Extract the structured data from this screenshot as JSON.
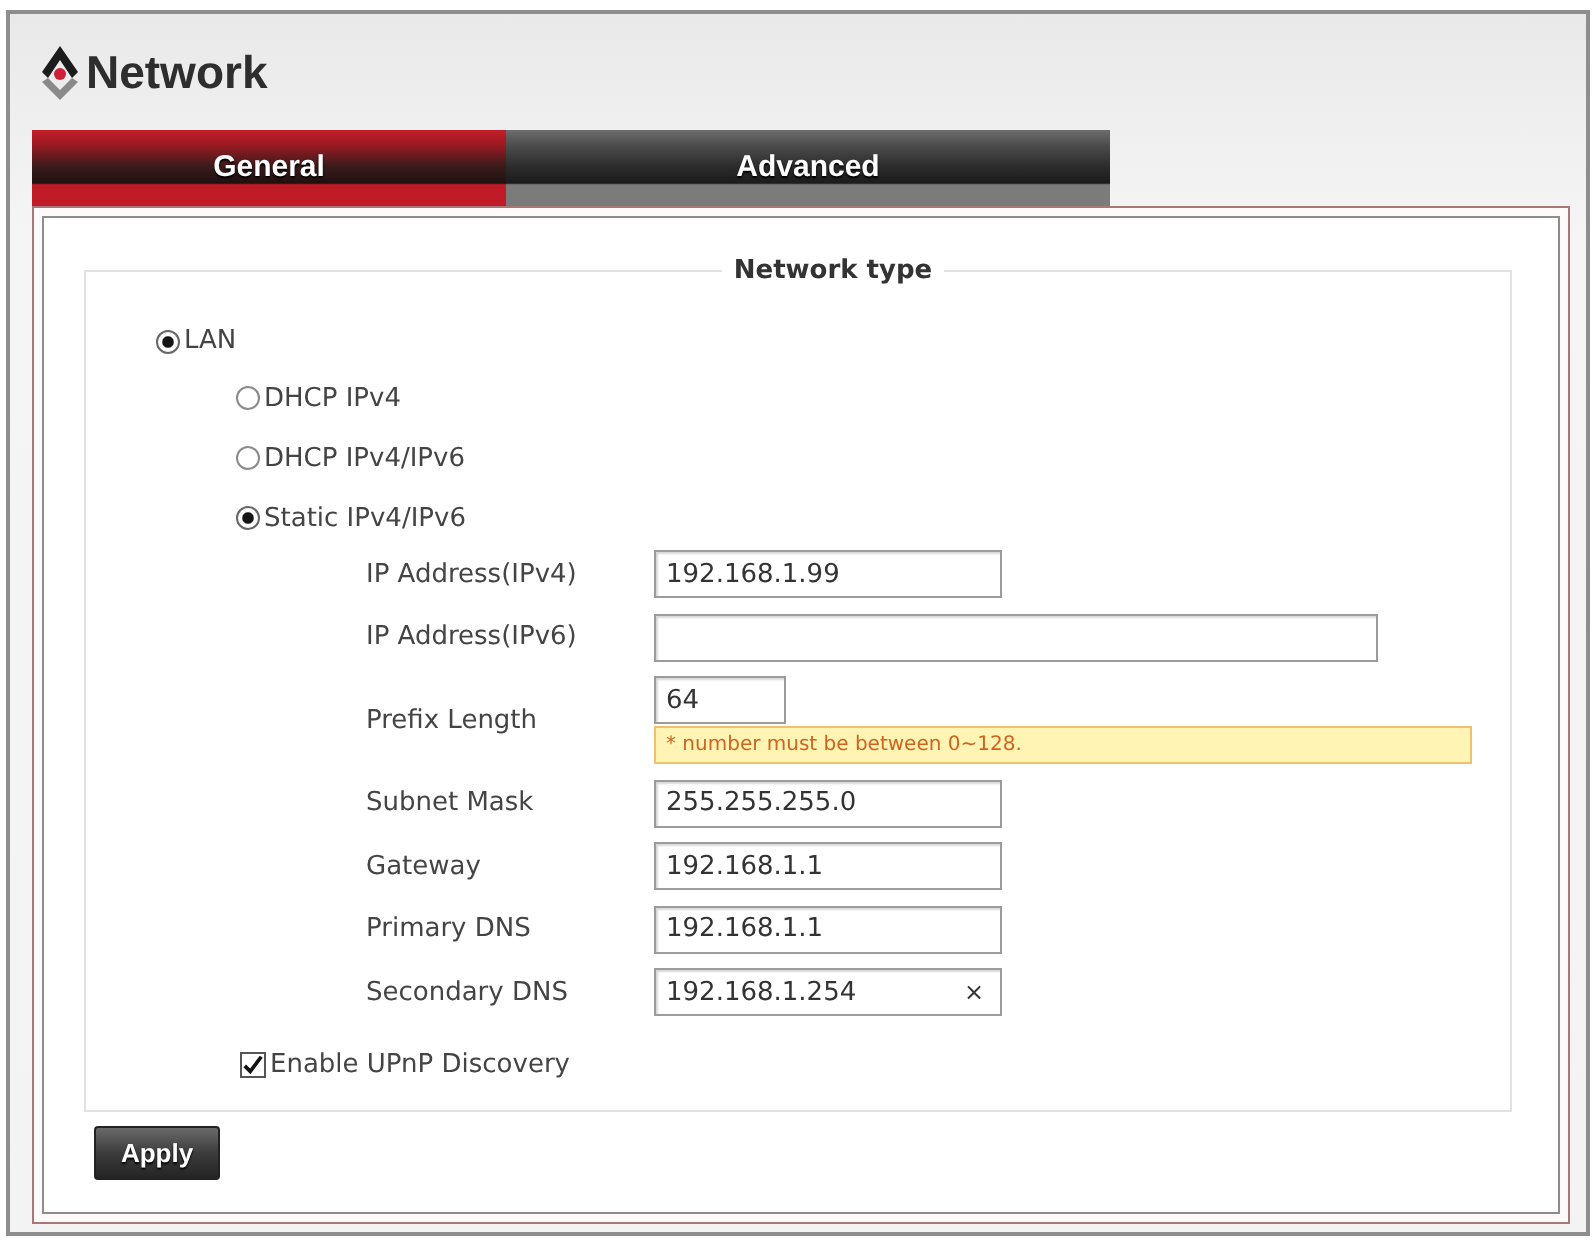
{
  "header": {
    "title": "Network"
  },
  "tabs": [
    {
      "label": "General",
      "selected": true
    },
    {
      "label": "Advanced",
      "selected": false
    }
  ],
  "network_type": {
    "legend": "Network type",
    "options": [
      {
        "label": "LAN",
        "selected": true,
        "children": [
          {
            "label": "DHCP IPv4",
            "selected": false
          },
          {
            "label": "DHCP IPv4/IPv6",
            "selected": false
          },
          {
            "label": "Static IPv4/IPv6",
            "selected": true,
            "fields": [
              {
                "label": "IP Address(IPv4)",
                "kind": "medium",
                "value": "192.168.1.99"
              },
              {
                "label": "IP Address(IPv6)",
                "kind": "wide"
              },
              {
                "label": "Prefix Length",
                "kind": "short",
                "value": "64",
                "hint": "* number must be between 0~128."
              },
              {
                "label": "Subnet Mask",
                "kind": "medium",
                "value": "255.255.255.0"
              },
              {
                "label": "Gateway",
                "kind": "medium",
                "value": "192.168.1.1"
              },
              {
                "label": "Primary DNS",
                "kind": "medium",
                "value": "192.168.1.1"
              },
              {
                "label": "Secondary DNS",
                "kind": "medium",
                "value": "192.168.1.254",
                "clear_button": "×"
              }
            ]
          }
        ]
      }
    ],
    "upnp": {
      "label": "Enable UPnP Discovery",
      "checked": true
    }
  },
  "apply_button": "Apply"
}
